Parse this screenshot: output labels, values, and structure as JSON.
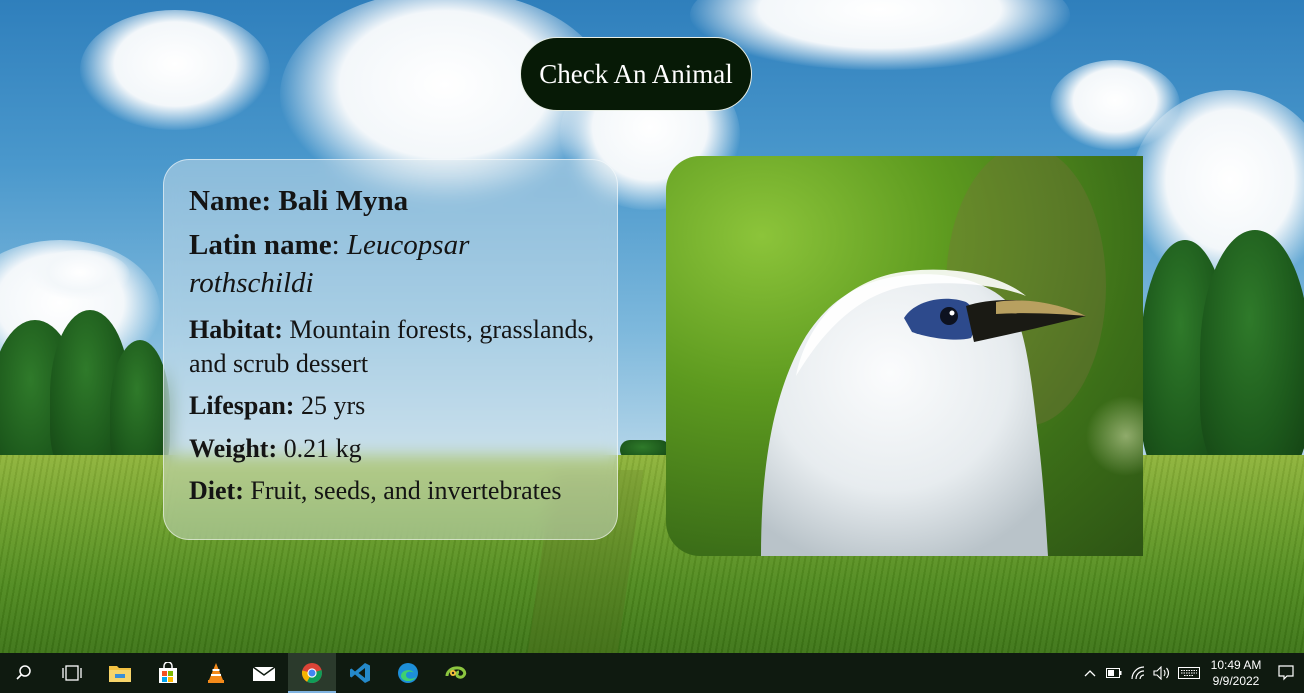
{
  "page": {
    "button_label": "Check An Animal"
  },
  "animal": {
    "name_label": "Name:",
    "name": "Bali Myna",
    "latin_label": "Latin name",
    "latin_sep": ":",
    "latin_name": "Leucopsar rothschildi",
    "habitat_label": "Habitat:",
    "habitat": "Mountain forests, grasslands, and scrub dessert",
    "lifespan_label": "Lifespan:",
    "lifespan": "25 yrs",
    "weight_label": "Weight:",
    "weight": "0.21 kg",
    "diet_label": "Diet:",
    "diet": "Fruit, seeds, and invertebrates"
  },
  "taskbar": {
    "apps": [
      {
        "icon": "search-icon"
      },
      {
        "icon": "task-view-icon"
      },
      {
        "icon": "file-explorer-icon"
      },
      {
        "icon": "microsoft-store-icon"
      },
      {
        "icon": "vlc-icon"
      },
      {
        "icon": "mail-icon"
      },
      {
        "icon": "chrome-icon",
        "active": true
      },
      {
        "icon": "vscode-icon"
      },
      {
        "icon": "edge-icon"
      },
      {
        "icon": "chameleon-app-icon"
      }
    ],
    "clock_time": "10:49 AM",
    "clock_date": "9/9/2022"
  },
  "colors": {
    "button_bg": "#071a06",
    "taskbar_bg": "#0f1a10",
    "card_bg": "rgba(230,238,240,0.42)"
  }
}
